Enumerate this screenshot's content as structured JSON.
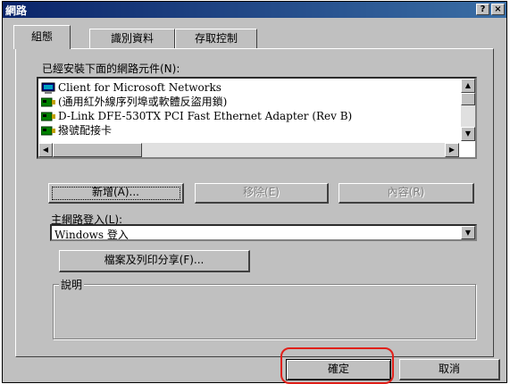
{
  "window": {
    "title": "網路",
    "help_label": "?",
    "close_label": "×"
  },
  "tabs": [
    {
      "label": "組態",
      "active": true
    },
    {
      "label": "識別資料",
      "active": false
    },
    {
      "label": "存取控制",
      "active": false
    }
  ],
  "components": {
    "label": "已經安裝下面的網路元件(N):",
    "items": [
      {
        "icon": "network-client-icon",
        "label": "Client for Microsoft Networks"
      },
      {
        "icon": "network-adapter-icon",
        "label": "(通用紅外線序列埠或軟體反盜用鎖)"
      },
      {
        "icon": "network-adapter-icon",
        "label": "D-Link DFE-530TX PCI Fast Ethernet Adapter (Rev B)"
      },
      {
        "icon": "network-adapter-icon",
        "label": "撥號配接卡"
      }
    ]
  },
  "buttons": {
    "add": "新增(A)...",
    "remove": "移除(E)",
    "properties": "內容(R)",
    "file_print_sharing": "檔案及列印分享(F)...",
    "ok": "確定",
    "cancel": "取消"
  },
  "primary_logon": {
    "label": "主網路登入(L):",
    "value": "Windows 登入"
  },
  "description": {
    "title": "說明"
  },
  "colors": {
    "titlebar": "#0a246a",
    "face": "#c0c0c0",
    "highlight_ring": "#e0201a"
  }
}
